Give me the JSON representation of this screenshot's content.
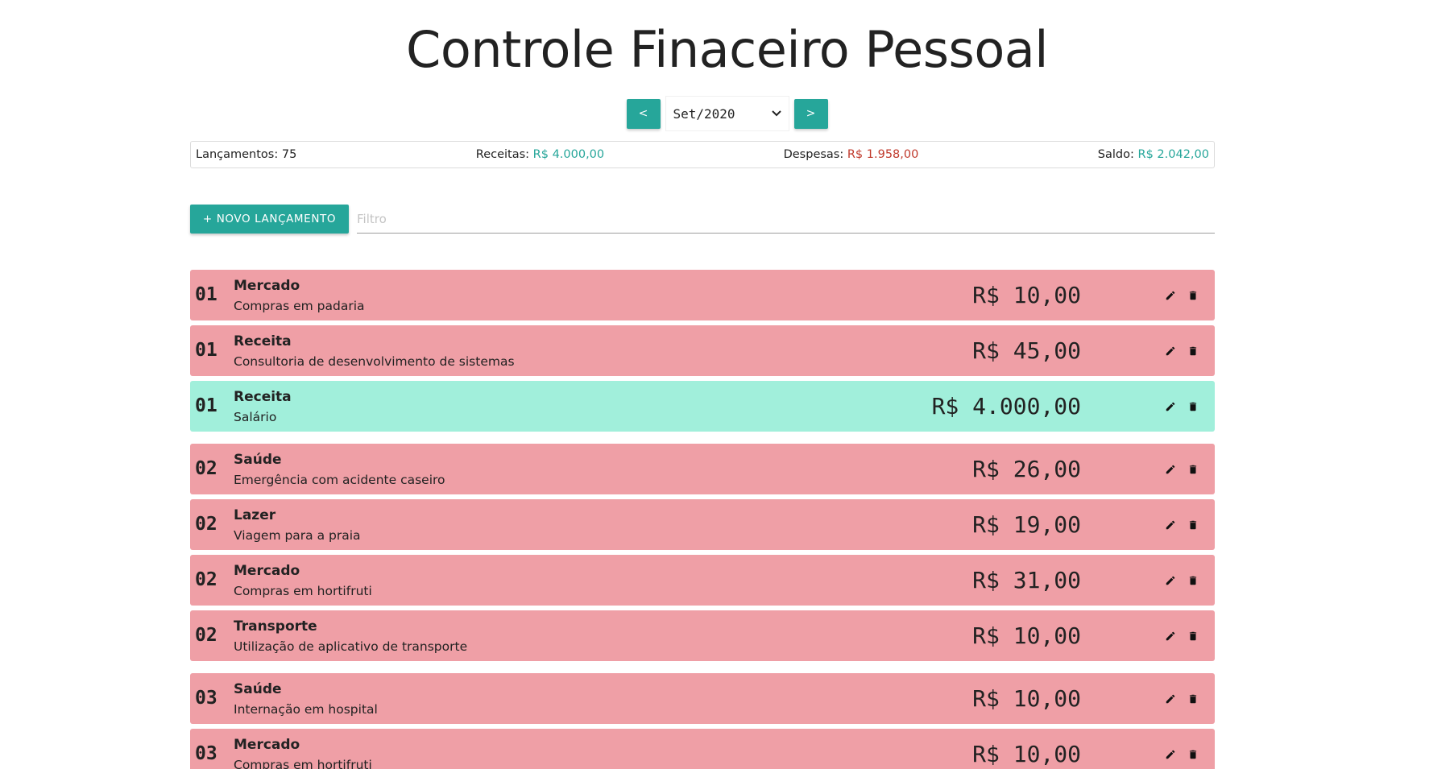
{
  "header": {
    "title": "Controle Finaceiro Pessoal"
  },
  "period": {
    "prev_label": "<",
    "next_label": ">",
    "selected": "Set/2020"
  },
  "summary": {
    "entries_label": "Lançamentos:",
    "entries_count": "75",
    "income_label": "Receitas:",
    "income_value": "R$ 4.000,00",
    "expense_label": "Despesas:",
    "expense_value": "R$ 1.958,00",
    "balance_label": "Saldo:",
    "balance_value": "R$ 2.042,00"
  },
  "toolbar": {
    "new_entry_label": "+ NOVO LANÇAMENTO",
    "filter_placeholder": "Filtro",
    "filter_value": ""
  },
  "entries": [
    {
      "day": "01",
      "category": "Mercado",
      "description": "Compras em padaria",
      "amount": "R$ 10,00",
      "type": "expense",
      "group_start": false
    },
    {
      "day": "01",
      "category": "Receita",
      "description": "Consultoria de desenvolvimento de sistemas",
      "amount": "R$ 45,00",
      "type": "expense",
      "group_start": false
    },
    {
      "day": "01",
      "category": "Receita",
      "description": "Salário",
      "amount": "R$ 4.000,00",
      "type": "income",
      "group_start": false
    },
    {
      "day": "02",
      "category": "Saúde",
      "description": "Emergência com acidente caseiro",
      "amount": "R$ 26,00",
      "type": "expense",
      "group_start": true
    },
    {
      "day": "02",
      "category": "Lazer",
      "description": "Viagem para a praia",
      "amount": "R$ 19,00",
      "type": "expense",
      "group_start": false
    },
    {
      "day": "02",
      "category": "Mercado",
      "description": "Compras em hortifruti",
      "amount": "R$ 31,00",
      "type": "expense",
      "group_start": false
    },
    {
      "day": "02",
      "category": "Transporte",
      "description": "Utilização de aplicativo de transporte",
      "amount": "R$ 10,00",
      "type": "expense",
      "group_start": false
    },
    {
      "day": "03",
      "category": "Saúde",
      "description": "Internação em hospital",
      "amount": "R$ 10,00",
      "type": "expense",
      "group_start": true
    },
    {
      "day": "03",
      "category": "Mercado",
      "description": "Compras em hortifruti",
      "amount": "R$ 10,00",
      "type": "expense",
      "group_start": false
    }
  ],
  "icons": {
    "edit": "pencil-icon",
    "delete": "trash-icon"
  },
  "colors": {
    "accent": "#26a69a",
    "income_text": "#26a69a",
    "expense_text": "#c0392b",
    "expense_row": "#ef9fa6",
    "income_row": "#a1efdb"
  }
}
